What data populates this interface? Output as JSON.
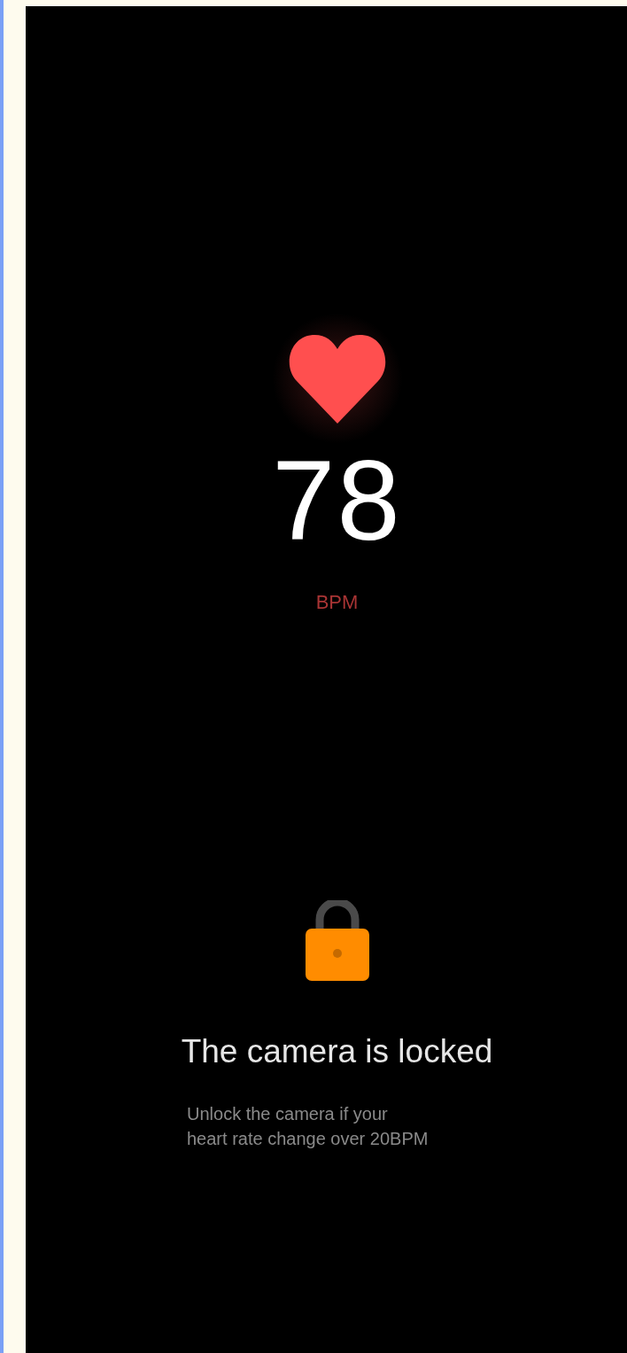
{
  "heart_rate": {
    "value": "78",
    "unit": "BPM"
  },
  "lock": {
    "title": "The camera is locked",
    "message": "Unlock the camera if your\nheart rate change over 20BPM"
  }
}
